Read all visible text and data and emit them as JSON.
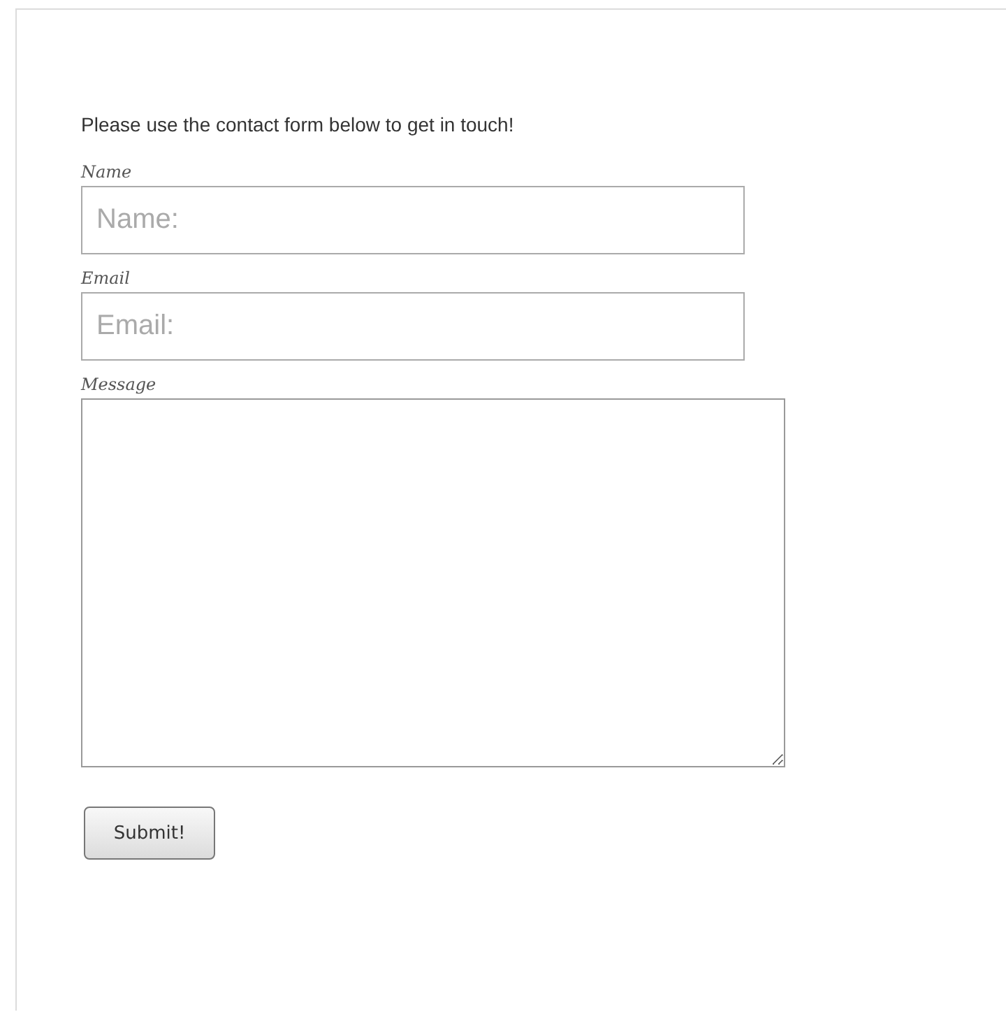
{
  "intro": "Please use the contact form below to get in touch!",
  "fields": [
    {
      "label": "Name",
      "kind": "text",
      "placeholder": "Name:"
    },
    {
      "label": "Email",
      "kind": "text",
      "placeholder": "Email:"
    },
    {
      "label": "Message",
      "kind": "textarea"
    }
  ],
  "submit": "Submit!"
}
